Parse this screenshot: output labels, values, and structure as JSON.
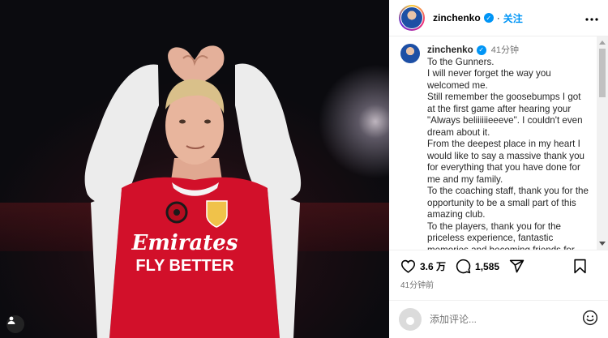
{
  "post": {
    "username": "zinchenko",
    "verified_mark": "✓",
    "follow_label": "关注",
    "more_label": "•••",
    "dot": "·"
  },
  "caption": {
    "username": "zinchenko",
    "time": "41分钟",
    "lines": [
      "To the Gunners.",
      "I will never forget the way you welcomed me.",
      "Still remember the goosebumps I got at the first game after hearing your \"Always beliiiiiieeeve\". I couldn't even dream about it.",
      "From the deepest place in my heart I would like to say a massive thank you for everything that you have done for me and my family.",
      "To the coaching staff, thank you for the opportunity to be a small part of this amazing club.",
      "To the players, thank you for the priceless experience, fantastic memories and becoming friends for"
    ]
  },
  "actions": {
    "likes": "3.6 万",
    "comments": "1,585",
    "posted_ago": "41分钟前"
  },
  "comment_box": {
    "placeholder": "添加评论..."
  },
  "icons": {
    "heart": "heart-icon",
    "comment": "comment-icon",
    "share": "share-icon",
    "save": "bookmark-icon",
    "emoji": "emoji-icon",
    "more": "more-icon",
    "mute": "user-tag-icon"
  },
  "colors": {
    "link_blue": "#0095f6",
    "kit_red": "#d2102a"
  },
  "jersey": {
    "sponsor_line1": "Emirates",
    "sponsor_line2": "FLY BETTER"
  }
}
